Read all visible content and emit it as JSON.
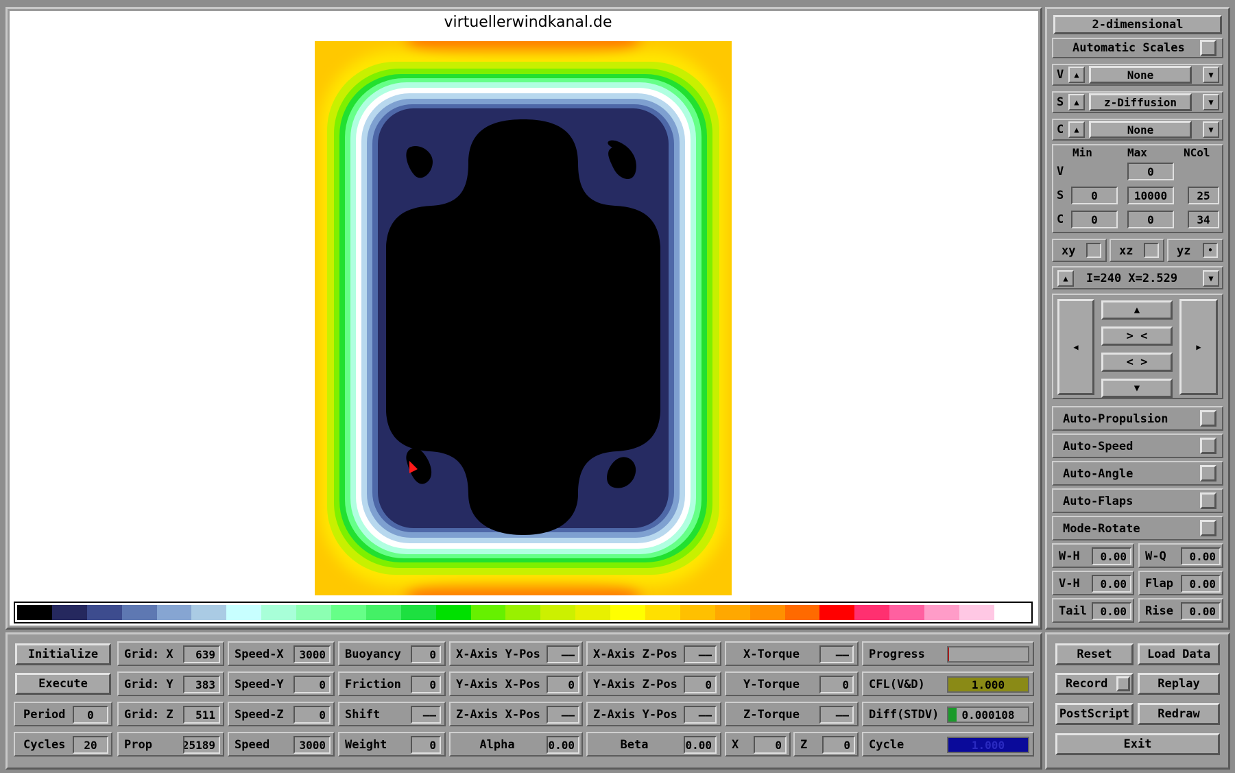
{
  "title": "virtuellerwindkanal.de",
  "colors": {
    "colorbar": [
      "#000000",
      "#25285e",
      "#3d4c8e",
      "#5e78b2",
      "#86a5d2",
      "#aacbe4",
      "#c8ffff",
      "#a8ffd8",
      "#8cffb2",
      "#66ff88",
      "#44f066",
      "#1de040",
      "#00e000",
      "#66f000",
      "#99f000",
      "#ccf000",
      "#e8f000",
      "#ffff00",
      "#ffe000",
      "#ffc000",
      "#ffa800",
      "#ff9000",
      "#ff6a00",
      "#ff0000",
      "#ff3070",
      "#ff60a0",
      "#ff9cc8",
      "#ffc8e4",
      "#ffffff"
    ]
  },
  "right": {
    "mode_button": "2-dimensional",
    "auto_scales": "Automatic Scales",
    "v_row": {
      "letter": "V",
      "value": "None"
    },
    "s_row": {
      "letter": "S",
      "value": "z-Diffusion"
    },
    "c_row": {
      "letter": "C",
      "value": "None"
    },
    "range": {
      "headers": [
        "Min",
        "Max",
        "NCol"
      ],
      "v": {
        "label": "V",
        "max": "0"
      },
      "s": {
        "label": "S",
        "min": "0",
        "max": "10000",
        "ncol": "25"
      },
      "c": {
        "label": "C",
        "min": "0",
        "max": "0",
        "ncol": "34"
      }
    },
    "planes": {
      "xy": "xy",
      "xz": "xz",
      "yz": "yz",
      "yz_mark": "•"
    },
    "slice": "I=240  X=2.529",
    "nav": {
      "up": "▲",
      "down": "▼",
      "left": "◀",
      "right": "▶",
      "zoom_in": "> <",
      "zoom_out": "< >"
    },
    "toggles": [
      "Auto-Propulsion",
      "Auto-Speed",
      "Auto-Angle",
      "Auto-Flaps",
      "Mode-Rotate"
    ],
    "params": [
      {
        "l1": "W-H",
        "v1": "0.00",
        "l2": "W-Q",
        "v2": "0.00"
      },
      {
        "l1": "V-H",
        "v1": "0.00",
        "l2": "Flap",
        "v2": "0.00"
      },
      {
        "l1": "Tail",
        "v1": "0.00",
        "l2": "Rise",
        "v2": "0.00"
      }
    ]
  },
  "bottom": {
    "initialize": "Initialize",
    "execute": "Execute",
    "period": {
      "label": "Period",
      "value": "0"
    },
    "cycles": {
      "label": "Cycles",
      "value": "20"
    },
    "grid_x": {
      "label": "Grid: X",
      "value": "639"
    },
    "grid_y": {
      "label": "Grid: Y",
      "value": "383"
    },
    "grid_z": {
      "label": "Grid: Z",
      "value": "511"
    },
    "prop": {
      "label": "Prop",
      "value": "25189"
    },
    "speed_x": {
      "label": "Speed-X",
      "value": "3000"
    },
    "speed_y": {
      "label": "Speed-Y",
      "value": "0"
    },
    "speed_z": {
      "label": "Speed-Z",
      "value": "0"
    },
    "speed": {
      "label": "Speed",
      "value": "3000"
    },
    "buoyancy": {
      "label": "Buoyancy",
      "value": "0"
    },
    "friction": {
      "label": "Friction",
      "value": "0"
    },
    "shift": {
      "label": "Shift",
      "value": "——"
    },
    "weight": {
      "label": "Weight",
      "value": "0"
    },
    "xaxis_ypos": {
      "label": "X-Axis Y-Pos",
      "value": "——"
    },
    "yaxis_xpos": {
      "label": "Y-Axis X-Pos",
      "value": "0"
    },
    "zaxis_xpos": {
      "label": "Z-Axis X-Pos",
      "value": "——"
    },
    "alpha": {
      "label": "Alpha",
      "value": "0.00"
    },
    "xaxis_zpos": {
      "label": "X-Axis Z-Pos",
      "value": "——"
    },
    "yaxis_zpos": {
      "label": "Y-Axis Z-Pos",
      "value": "0"
    },
    "zaxis_ypos": {
      "label": "Z-Axis Y-Pos",
      "value": "——"
    },
    "beta": {
      "label": "Beta",
      "value": "0.00"
    },
    "x_torque": {
      "label": "X-Torque",
      "value": "——"
    },
    "y_torque": {
      "label": "Y-Torque",
      "value": "0"
    },
    "z_torque": {
      "label": "Z-Torque",
      "value": "——"
    },
    "x": {
      "label": "X",
      "value": "0"
    },
    "z": {
      "label": "Z",
      "value": "0"
    },
    "progress": {
      "label": "Progress",
      "fraction": 0.01
    },
    "cfl": {
      "label": "CFL(V&D)",
      "value": "1.000",
      "fraction": 1.0
    },
    "diff": {
      "label": "Diff(STDV)",
      "value": "0.000108",
      "fraction": 0.1
    },
    "cycle": {
      "label": "Cycle",
      "value": "1.000",
      "fraction": 1.0
    },
    "reset": "Reset",
    "load_data": "Load Data",
    "record": "Record",
    "replay": "Replay",
    "postscript": "PostScript",
    "redraw": "Redraw",
    "exit": "Exit"
  }
}
